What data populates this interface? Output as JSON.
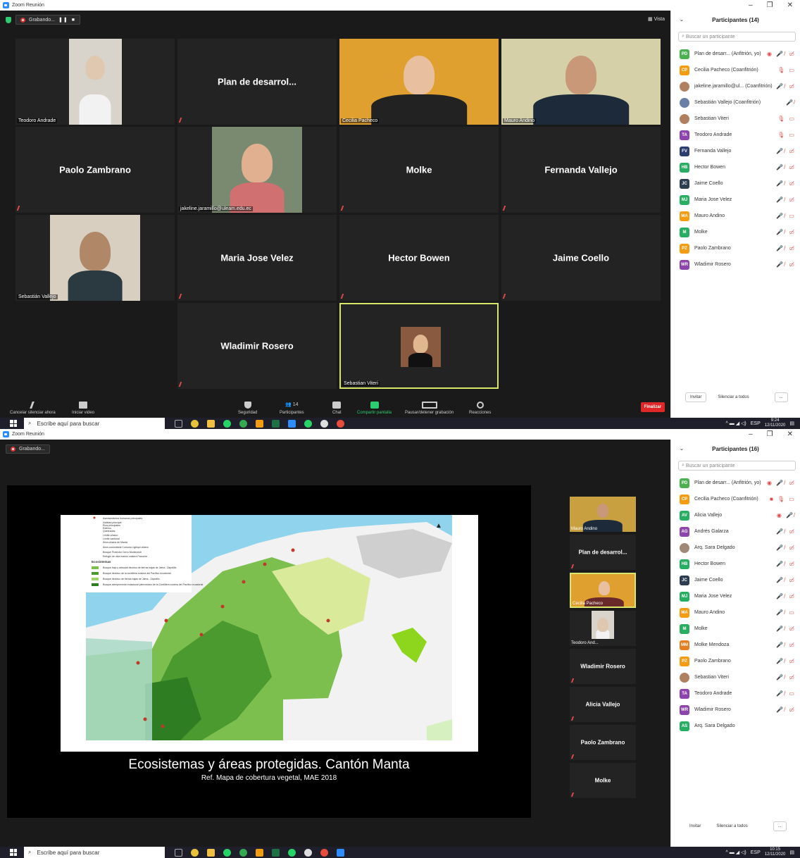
{
  "s1": {
    "window_title": "Zoom Reunión",
    "recording_label": "Grabando...",
    "view_label": "Vista",
    "tiles": [
      {
        "name": "Teodoro Andrade",
        "label": "Teodoro Andrade",
        "video": true
      },
      {
        "name": "Plan de desarrol...",
        "label": "",
        "video": false
      },
      {
        "name": "Cecilia Pacheco",
        "label": "Cecilia Pacheco",
        "video": true
      },
      {
        "name": "Mauro Andino",
        "label": "Mauro Andino",
        "video": true
      },
      {
        "name": "Paolo Zambrano",
        "label": "",
        "video": false
      },
      {
        "name": "jakeline.jaramillo@uleam.edu.ec",
        "label": "jakeline.jaramillo@uleam.edu.ec",
        "video": true
      },
      {
        "name": "Molke",
        "label": "",
        "video": false
      },
      {
        "name": "Fernanda Vallejo",
        "label": "",
        "video": false
      },
      {
        "name": "Sebastián Vallejo",
        "label": "Sebastián Vallejo",
        "video": true
      },
      {
        "name": "Maria Jose Velez",
        "label": "",
        "video": false
      },
      {
        "name": "Hector Bowen",
        "label": "",
        "video": false
      },
      {
        "name": "Jaime Coello",
        "label": "",
        "video": false
      },
      {
        "name": "Wladimir Rosero",
        "label": "",
        "video": false
      },
      {
        "name": "Sebastian Viteri",
        "label": "Sebastian Viteri",
        "video": true
      }
    ],
    "toolbar": {
      "unmute": "Cancelar silenciar ahora",
      "video": "Iniciar video",
      "security": "Seguridad",
      "participants": "Participantes",
      "participants_count": "14",
      "chat": "Chat",
      "share": "Compartir pantalla",
      "pause_rec": "Pausar/detener grabación",
      "reactions": "Reacciones",
      "end": "Finalizar"
    },
    "panel": {
      "title": "Participantes (14)",
      "search_placeholder": "Buscar un participante",
      "participants": [
        {
          "initials": "PD",
          "color": "#4caf50",
          "name": "Plan de desarr... (Anfitrión, yo)",
          "icons": "◉ 🎤̸ ▭̸"
        },
        {
          "initials": "CP",
          "color": "#f39c12",
          "name": "Cecilia Pacheco (Coanfitrión)",
          "icons": "🎙 ▭"
        },
        {
          "initials": "",
          "color": "#b08060",
          "name": "jakeline.jaramillo@ul... (Coanfitrión)",
          "icons": "🎤̸ ▭̸"
        },
        {
          "initials": "",
          "color": "#6a7fa8",
          "name": "Sebastián Vallejo (Coanfitrión)",
          "icons": "🎤̸"
        },
        {
          "initials": "",
          "color": "#b08060",
          "name": "Sebastian Viteri",
          "icons": "🎙 ▭"
        },
        {
          "initials": "TA",
          "color": "#8e44ad",
          "name": "Teodoro Andrade",
          "icons": "🎙 ▭"
        },
        {
          "initials": "FV",
          "color": "#2c3e70",
          "name": "Fernanda Vallejo",
          "icons": "🎤̸ ▭̸"
        },
        {
          "initials": "HB",
          "color": "#27ae60",
          "name": "Hector Bowen",
          "icons": "🎤̸ ▭̸"
        },
        {
          "initials": "JC",
          "color": "#2c3e50",
          "name": "Jaime Coello",
          "icons": "🎤̸ ▭̸"
        },
        {
          "initials": "MJ",
          "color": "#27ae60",
          "name": "Maria Jose Velez",
          "icons": "🎤̸ ▭̸"
        },
        {
          "initials": "MA",
          "color": "#f39c12",
          "name": "Mauro Andino",
          "icons": "🎤̸ ▭"
        },
        {
          "initials": "M",
          "color": "#27ae60",
          "name": "Molke",
          "icons": "🎤̸ ▭̸"
        },
        {
          "initials": "PZ",
          "color": "#f39c12",
          "name": "Paolo Zambrano",
          "icons": "🎤̸ ▭̸"
        },
        {
          "initials": "WR",
          "color": "#8e44ad",
          "name": "Wladimir Rosero",
          "icons": "🎤̸ ▭̸"
        }
      ],
      "invite": "Invitar",
      "mute_all": "Silenciar a todos",
      "more": "..."
    },
    "taskbar": {
      "search": "Escribe aquí para buscar",
      "lang": "ESP",
      "time": "9:24",
      "date": "12/11/2020"
    }
  },
  "s2": {
    "window_title": "Zoom Reunión",
    "recording_label": "Grabando...",
    "slide_title": "Ecosistemas y áreas protegidas. Cantón Manta",
    "slide_subtitle": "Ref. Mapa de cobertura vegetal, MAE 2018",
    "legend": [
      "Asentamientos humanos principales",
      "Vialidad principal",
      "Ríos principales",
      "Esteros",
      "Quebradas",
      "Límite urbano",
      "Límite cantonal",
      "Área urbana de Manta",
      "Área comunitaria Comuna Ligüiqui afuera",
      "Bosque Protector Cerro Montecristi",
      "Refugio de vida marino costera Pacoche"
    ],
    "legend_heading": "Ecosistemas",
    "legend_eco": [
      "Bosque bajo y arbustal deciduo de tierras bajas de Jama - Zapotillo",
      "Bosque deciduo de la cordillera costera del Pacífico ecuatorial",
      "Bosque deciduo de tierras bajas de Jama - Zapotillo",
      "Bosque siempreverde estacional piemontano de la Cordillera costera del Pacífico ecuatorial"
    ],
    "thumbs": [
      {
        "name": "Mauro Andino",
        "label": "Mauro Andino",
        "video": true,
        "active": false
      },
      {
        "name": "Plan de desarrol...",
        "label": "",
        "video": false,
        "active": false
      },
      {
        "name": "Cecilia Pacheco",
        "label": "Cecilia Pacheco",
        "video": true,
        "active": true
      },
      {
        "name": "Teodoro And...",
        "label": "Teodoro And...",
        "video": true,
        "active": false
      },
      {
        "name": "Wladimir Rosero",
        "label": "",
        "video": false,
        "active": false
      },
      {
        "name": "Alicia Vallejo",
        "label": "",
        "video": false,
        "active": false
      },
      {
        "name": "Paolo Zambrano",
        "label": "",
        "video": false,
        "active": false
      },
      {
        "name": "Molke",
        "label": "",
        "video": false,
        "active": false
      }
    ],
    "panel": {
      "title": "Participantes (16)",
      "search_placeholder": "Buscar un participante",
      "participants": [
        {
          "initials": "PD",
          "color": "#4caf50",
          "name": "Plan de desarr... (Anfitrión, yo)",
          "icons": "◉ 🎤̸ ▭̸"
        },
        {
          "initials": "CP",
          "color": "#f39c12",
          "name": "Cecilia Pacheco (Coanfitrión)",
          "icons": "■ 🎙 ▭"
        },
        {
          "initials": "AV",
          "color": "#27ae60",
          "name": "Alicia Vallejo",
          "icons": "◉ 🎤̸"
        },
        {
          "initials": "AG",
          "color": "#8e44ad",
          "name": "Andrés Galarza",
          "icons": "🎤̸ ▭̸"
        },
        {
          "initials": "",
          "color": "#a08878",
          "name": "Arq. Sara Delgado",
          "icons": "🎤̸ ▭̸"
        },
        {
          "initials": "HB",
          "color": "#27ae60",
          "name": "Hector Bowen",
          "icons": "🎤̸ ▭̸"
        },
        {
          "initials": "JC",
          "color": "#2c3e50",
          "name": "Jaime Coello",
          "icons": "🎤̸ ▭̸"
        },
        {
          "initials": "MJ",
          "color": "#27ae60",
          "name": "Maria Jose Velez",
          "icons": "🎤̸ ▭̸"
        },
        {
          "initials": "MA",
          "color": "#f39c12",
          "name": "Mauro Andino",
          "icons": "🎤̸ ▭"
        },
        {
          "initials": "M",
          "color": "#27ae60",
          "name": "Molke",
          "icons": "🎤̸ ▭̸"
        },
        {
          "initials": "MM",
          "color": "#e67e22",
          "name": "Molke Mendoza",
          "icons": "🎤̸ ▭̸"
        },
        {
          "initials": "PZ",
          "color": "#f39c12",
          "name": "Paolo Zambrano",
          "icons": "🎤̸ ▭̸"
        },
        {
          "initials": "",
          "color": "#b08060",
          "name": "Sebastian Viteri",
          "icons": "🎤̸ ▭̸"
        },
        {
          "initials": "TA",
          "color": "#8e44ad",
          "name": "Teodoro Andrade",
          "icons": "🎤̸ ▭"
        },
        {
          "initials": "WR",
          "color": "#8e44ad",
          "name": "Wladimir Rosero",
          "icons": "🎤̸ ▭̸"
        },
        {
          "initials": "AS",
          "color": "#27ae60",
          "name": "Arq. Sara Delgado",
          "icons": ""
        }
      ],
      "invite": "Invitar",
      "mute_all": "Silenciar a todos",
      "more": "..."
    },
    "taskbar": {
      "search": "Escribe aquí para buscar",
      "lang": "ESP",
      "time": "10:15",
      "date": "12/11/2020"
    }
  }
}
